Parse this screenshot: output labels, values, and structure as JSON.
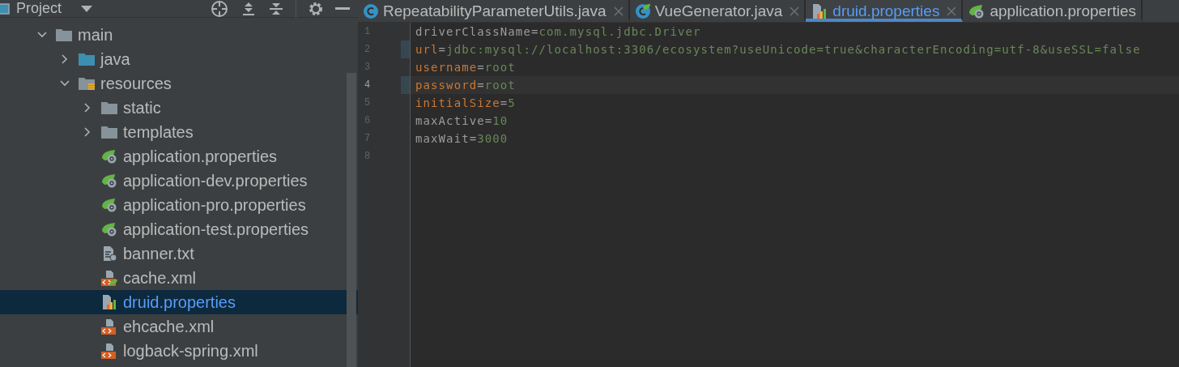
{
  "project_panel": {
    "title": "Project",
    "tree": [
      {
        "name": "main",
        "kind": "folder",
        "expanded": true,
        "selected": false,
        "children": [
          {
            "name": "java",
            "kind": "source-folder",
            "expanded": false,
            "selected": false
          },
          {
            "name": "resources",
            "kind": "resource-folder",
            "expanded": true,
            "selected": false,
            "children": [
              {
                "name": "static",
                "kind": "folder",
                "expanded": false,
                "selected": false
              },
              {
                "name": "templates",
                "kind": "folder",
                "expanded": false,
                "selected": false
              },
              {
                "name": "application.properties",
                "kind": "spring-properties",
                "selected": false
              },
              {
                "name": "application-dev.properties",
                "kind": "spring-properties",
                "selected": false
              },
              {
                "name": "application-pro.properties",
                "kind": "spring-properties",
                "selected": false
              },
              {
                "name": "application-test.properties",
                "kind": "spring-properties",
                "selected": false
              },
              {
                "name": "banner.txt",
                "kind": "text",
                "selected": false
              },
              {
                "name": "cache.xml",
                "kind": "spring-xml",
                "selected": false
              },
              {
                "name": "druid.properties",
                "kind": "chart-properties",
                "selected": true
              },
              {
                "name": "ehcache.xml",
                "kind": "xml",
                "selected": false
              },
              {
                "name": "logback-spring.xml",
                "kind": "xml",
                "selected": false
              }
            ]
          }
        ]
      }
    ]
  },
  "tabs": [
    {
      "label": "RepeatabilityParameterUtils.java",
      "kind": "class",
      "selected": false,
      "closable": true
    },
    {
      "label": "VueGenerator.java",
      "kind": "spring-class",
      "selected": false,
      "closable": true
    },
    {
      "label": "druid.properties",
      "kind": "chart-properties",
      "selected": true,
      "closable": true
    },
    {
      "label": "application.properties",
      "kind": "spring-properties",
      "selected": false,
      "closable": false
    }
  ],
  "editor": {
    "lines": [
      {
        "number": "1",
        "key": "driverClassName",
        "separator": "=",
        "value": "com.mysql.jdbc.Driver",
        "known_key": false,
        "changed": false,
        "current": false
      },
      {
        "number": "2",
        "key": "url",
        "separator": "=",
        "value": "jdbc:mysql://localhost:3306/ecosystem?useUnicode=true&characterEncoding=utf-8&useSSL=false",
        "known_key": true,
        "changed": true,
        "current": false
      },
      {
        "number": "3",
        "key": "username",
        "separator": "=",
        "value": "root",
        "known_key": true,
        "changed": false,
        "current": false
      },
      {
        "number": "4",
        "key": "password",
        "separator": "=",
        "value": "root",
        "known_key": true,
        "changed": true,
        "current": true
      },
      {
        "number": "5",
        "key": "initialSize",
        "separator": "=",
        "value": "5",
        "known_key": true,
        "changed": false,
        "current": false
      },
      {
        "number": "6",
        "key": "maxActive",
        "separator": "=",
        "value": "10",
        "known_key": false,
        "changed": false,
        "current": false
      },
      {
        "number": "7",
        "key": "maxWait",
        "separator": "=",
        "value": "3000",
        "known_key": false,
        "changed": false,
        "current": false
      },
      {
        "number": "8",
        "changed": false,
        "current": false
      }
    ]
  }
}
